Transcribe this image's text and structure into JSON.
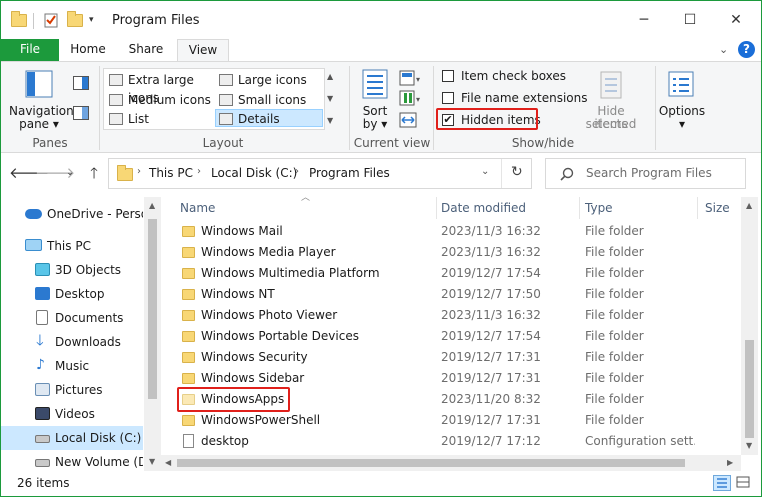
{
  "window": {
    "title": "Program Files",
    "accent": "#1c9a3c",
    "controls": {
      "minimize": "─",
      "maximize": "☐",
      "close": "✕"
    }
  },
  "ribbon_tabs": [
    {
      "label": "File"
    },
    {
      "label": "Home"
    },
    {
      "label": "Share"
    },
    {
      "label": "View"
    }
  ],
  "ribbon": {
    "panes": {
      "nav_label": "Navigation",
      "nav_label2": "pane",
      "group": "Panes"
    },
    "layout": {
      "group": "Layout",
      "items": [
        {
          "label": "Extra large icons"
        },
        {
          "label": "Large icons"
        },
        {
          "label": "Medium icons"
        },
        {
          "label": "Small icons"
        },
        {
          "label": "List"
        },
        {
          "label": "Details"
        }
      ]
    },
    "current_view": {
      "sort": "Sort",
      "sort2": "by",
      "group": "Current view"
    },
    "show_hide": {
      "group": "Show/hide",
      "item_check_boxes": "Item check boxes",
      "file_name_extensions": "File name extensions",
      "hidden_items": "Hidden items",
      "hide_selected": "Hide selected",
      "hide_selected2": "items"
    },
    "options": "Options"
  },
  "address": {
    "crumbs": [
      "This PC",
      "Local Disk (C:)",
      "Program Files"
    ],
    "search_placeholder": "Search Program Files"
  },
  "sidebar": {
    "items": [
      {
        "label": "OneDrive - Person"
      },
      {
        "label": "This PC"
      },
      {
        "label": "3D Objects"
      },
      {
        "label": "Desktop"
      },
      {
        "label": "Documents"
      },
      {
        "label": "Downloads"
      },
      {
        "label": "Music"
      },
      {
        "label": "Pictures"
      },
      {
        "label": "Videos"
      },
      {
        "label": "Local Disk (C:)"
      },
      {
        "label": "New Volume (D:"
      }
    ]
  },
  "columns": {
    "name": "Name",
    "date": "Date modified",
    "type": "Type",
    "size": "Size"
  },
  "files": [
    {
      "name": "Windows Mail",
      "date": "2023/11/3 16:32",
      "type": "File folder"
    },
    {
      "name": "Windows Media Player",
      "date": "2023/11/3 16:32",
      "type": "File folder"
    },
    {
      "name": "Windows Multimedia Platform",
      "date": "2019/12/7 17:54",
      "type": "File folder"
    },
    {
      "name": "Windows NT",
      "date": "2019/12/7 17:50",
      "type": "File folder"
    },
    {
      "name": "Windows Photo Viewer",
      "date": "2023/11/3 16:32",
      "type": "File folder"
    },
    {
      "name": "Windows Portable Devices",
      "date": "2019/12/7 17:54",
      "type": "File folder"
    },
    {
      "name": "Windows Security",
      "date": "2019/12/7 17:31",
      "type": "File folder"
    },
    {
      "name": "Windows Sidebar",
      "date": "2019/12/7 17:31",
      "type": "File folder"
    },
    {
      "name": "WindowsApps",
      "date": "2023/11/20 8:32",
      "type": "File folder"
    },
    {
      "name": "WindowsPowerShell",
      "date": "2019/12/7 17:31",
      "type": "File folder"
    },
    {
      "name": "desktop",
      "date": "2019/12/7 17:12",
      "type": "Configuration sett..."
    }
  ],
  "status": {
    "count": "26 items"
  }
}
